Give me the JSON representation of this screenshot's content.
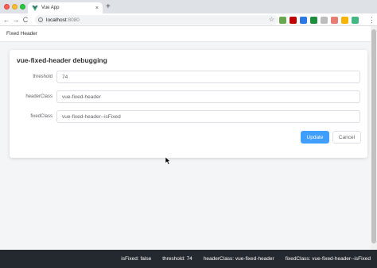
{
  "browser": {
    "tab_title": "Vue App",
    "tab_close": "×",
    "new_tab": "+",
    "url_host": "localhost",
    "url_port": ":8080",
    "nav_back": "←",
    "nav_forward": "→",
    "nav_reload": "C",
    "star": "☆",
    "menu": "⋮",
    "info": "i",
    "extension_colors": [
      "#6aa84f",
      "#c00000",
      "#2b78e4",
      "#1e8e3e",
      "#bdbdbd",
      "#e67c73",
      "#f4b400",
      "#42b883"
    ]
  },
  "app": {
    "title": "Fixed Header"
  },
  "card": {
    "title": "vue-fixed-header debugging",
    "fields": [
      {
        "label": "threshold",
        "value": "74"
      },
      {
        "label": "headerClass",
        "value": "vue-fixed-header"
      },
      {
        "label": "fixedClass",
        "value": "vue-fixed-header--isFixed"
      }
    ],
    "update_label": "Update",
    "cancel_label": "Cancel"
  },
  "status": {
    "items": [
      "isFixed: false",
      "threshold: 74",
      "headerClass: vue-fixed-header",
      "fixedClass: vue-fixed-header--isFixed"
    ]
  },
  "colors": {
    "primary": "#409eff",
    "statusbar_bg": "#23292f",
    "vue_green": "#42b883"
  }
}
